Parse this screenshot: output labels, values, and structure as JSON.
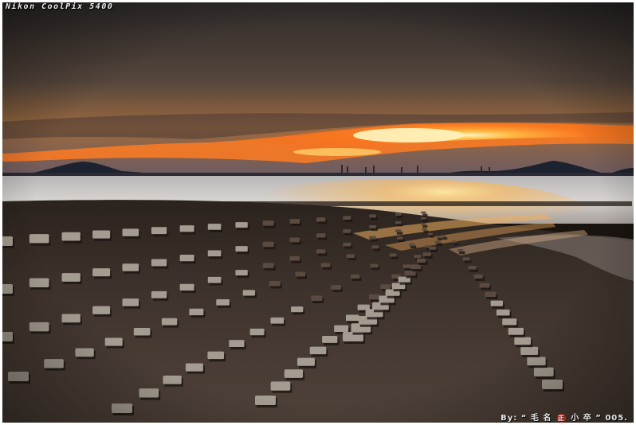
{
  "image": {
    "camera_label": "Nikon CoolPix 5400",
    "credit": {
      "prefix": "By: “ 毛 名",
      "seal": "正",
      "suffix": "小 卒 ” 005."
    }
  },
  "colors": {
    "sky_top": "#3a3430",
    "sky_glow": "#ff9a2a",
    "sun_core": "#fff1b0",
    "water": "#c9c7c8",
    "mud": "#4a3d35",
    "stone": "#a49c90"
  }
}
